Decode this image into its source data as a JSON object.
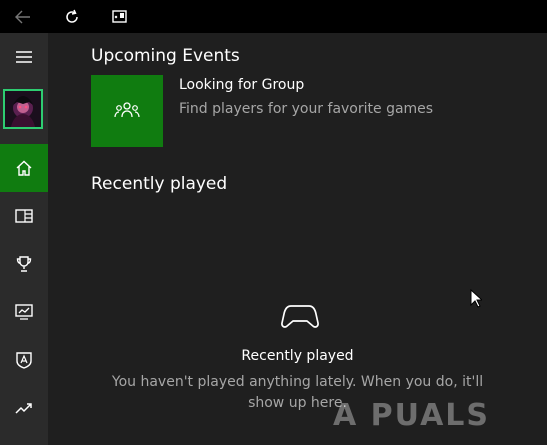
{
  "titlebar": {
    "back_icon": "back-arrow-icon",
    "refresh_icon": "refresh-icon",
    "snap_icon": "snap-view-icon"
  },
  "sidebar": {
    "menu_icon": "hamburger-menu-icon",
    "items": [
      {
        "icon": "home-icon",
        "active": true
      },
      {
        "icon": "my-games-icon",
        "active": false
      },
      {
        "icon": "achievements-trophy-icon",
        "active": false
      },
      {
        "icon": "game-dvr-icon",
        "active": false
      },
      {
        "icon": "clubs-shield-icon",
        "active": false
      },
      {
        "icon": "trending-icon",
        "active": false
      }
    ]
  },
  "main": {
    "upcoming_events": {
      "heading": "Upcoming Events",
      "event": {
        "title": "Looking for Group",
        "subtitle": "Find players for your favorite games"
      }
    },
    "recently_played": {
      "heading": "Recently played",
      "empty_title": "Recently played",
      "empty_message": "You haven't played anything lately.  When you do, it'll show up here."
    }
  },
  "watermark": "A PUALS",
  "colors": {
    "accent": "#107c10",
    "avatar_border": "#2ecc71",
    "sidebar_bg": "#2b2b2b",
    "main_bg": "#1f1f1f",
    "titlebar_bg": "#000000"
  }
}
